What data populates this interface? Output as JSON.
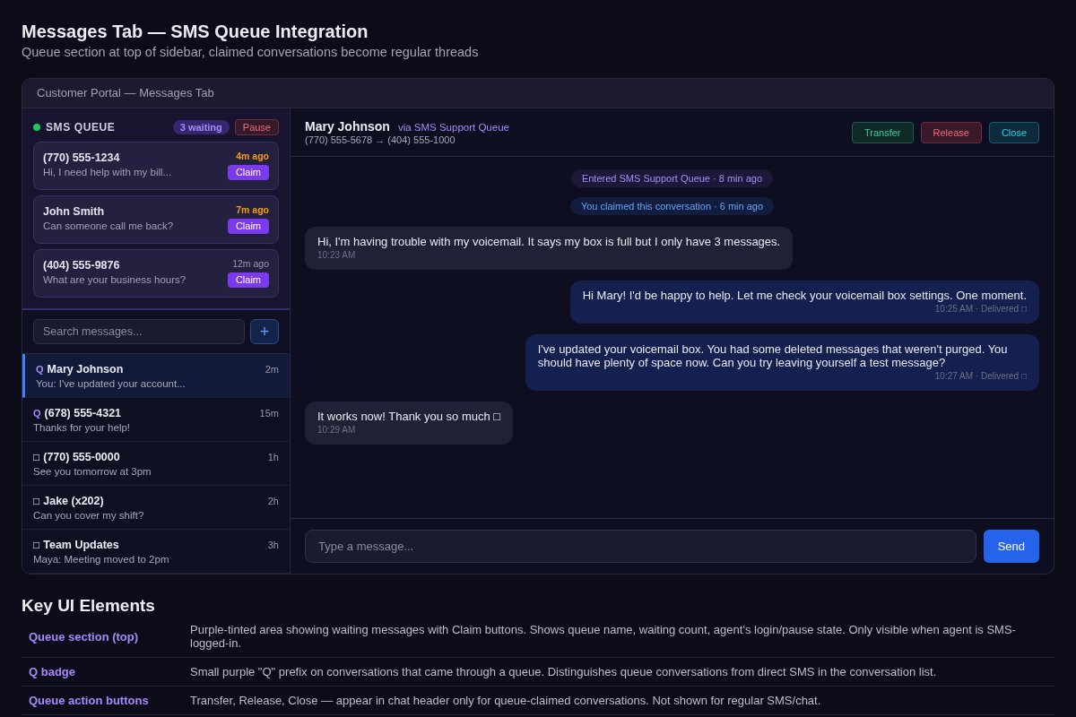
{
  "page": {
    "title": "Messages Tab — SMS Queue Integration",
    "subtitle": "Queue section at top of sidebar, claimed conversations become regular threads"
  },
  "portal": {
    "title": "Customer Portal — Messages Tab"
  },
  "queue": {
    "label": "SMS QUEUE",
    "online": true,
    "waiting": "3 waiting",
    "pause_button": "Pause",
    "items": [
      {
        "name": "(770) 555-1234",
        "preview": "Hi, I need help with my bill...",
        "time": "4m ago",
        "overdue": true,
        "claim": "Claim"
      },
      {
        "name": "John Smith",
        "preview": "Can someone call me back?",
        "time": "7m ago",
        "overdue": true,
        "claim": "Claim"
      },
      {
        "name": "(404) 555-9876",
        "preview": "What are your business hours?",
        "time": "12m ago",
        "overdue": false,
        "claim": "Claim"
      }
    ]
  },
  "search": {
    "placeholder": "Search messages...",
    "new_button": "+"
  },
  "conversations": [
    {
      "kind": "queue",
      "prefix": "Q",
      "name": "Mary Johnson",
      "preview": "You: I've updated your account...",
      "time": "2m",
      "selected": true
    },
    {
      "kind": "queue",
      "prefix": "Q",
      "name": "(678) 555-4321",
      "preview": "Thanks for your help!",
      "time": "15m",
      "selected": false
    },
    {
      "kind": "direct",
      "prefix": "□",
      "name": "(770) 555-0000",
      "preview": "See you tomorrow at 3pm",
      "time": "1h",
      "selected": false
    },
    {
      "kind": "direct",
      "prefix": "□",
      "name": "Jake (x202)",
      "preview": "Can you cover my shift?",
      "time": "2h",
      "selected": false
    },
    {
      "kind": "direct",
      "prefix": "□",
      "name": "Team Updates",
      "preview": "Maya: Meeting moved to 2pm",
      "time": "3h",
      "selected": false
    }
  ],
  "chat": {
    "name": "Mary Johnson",
    "via": "via SMS Support Queue",
    "route": "(770) 555-5678 → (404) 555-1000",
    "actions": [
      {
        "kind": "transfer",
        "label": "Transfer"
      },
      {
        "kind": "release",
        "label": "Release"
      },
      {
        "kind": "close",
        "label": "Close"
      }
    ],
    "events": [
      {
        "kind": "queue",
        "text": "Entered SMS Support Queue · 8 min ago"
      },
      {
        "kind": "claim",
        "text": "You claimed this conversation · 6 min ago"
      }
    ],
    "messages": [
      {
        "kind": "incoming",
        "text": "Hi, I'm having trouble with my voicemail. It says my box is full but I only have 3 messages.",
        "meta": "10:23 AM"
      },
      {
        "kind": "outgoing",
        "text": "Hi Mary! I'd be happy to help. Let me check your voicemail box settings. One moment.",
        "meta": "10:25 AM · Delivered □"
      },
      {
        "kind": "outgoing",
        "text": "I've updated your voicemail box. You had some deleted messages that weren't purged. You should have plenty of space now. Can you try leaving yourself a test message?",
        "meta": "10:27 AM · Delivered □"
      },
      {
        "kind": "incoming",
        "text": "It works now! Thank you so much □",
        "meta": "10:29 AM"
      }
    ],
    "composer": {
      "placeholder": "Type a message...",
      "send": "Send"
    }
  },
  "key_elements": {
    "title": "Key UI Elements",
    "rows": [
      {
        "term": "Queue section (top)",
        "description": "Purple-tinted area showing waiting messages with Claim buttons. Shows queue name, waiting count, agent's login/pause state. Only visible when agent is SMS-logged-in."
      },
      {
        "term": "Q badge",
        "description": "Small purple \"Q\" prefix on conversations that came through a queue. Distinguishes queue conversations from direct SMS in the conversation list."
      },
      {
        "term": "Queue action buttons",
        "description": "Transfer, Release, Close — appear in chat header only for queue-claimed conversations. Not shown for regular SMS/chat."
      }
    ]
  }
}
